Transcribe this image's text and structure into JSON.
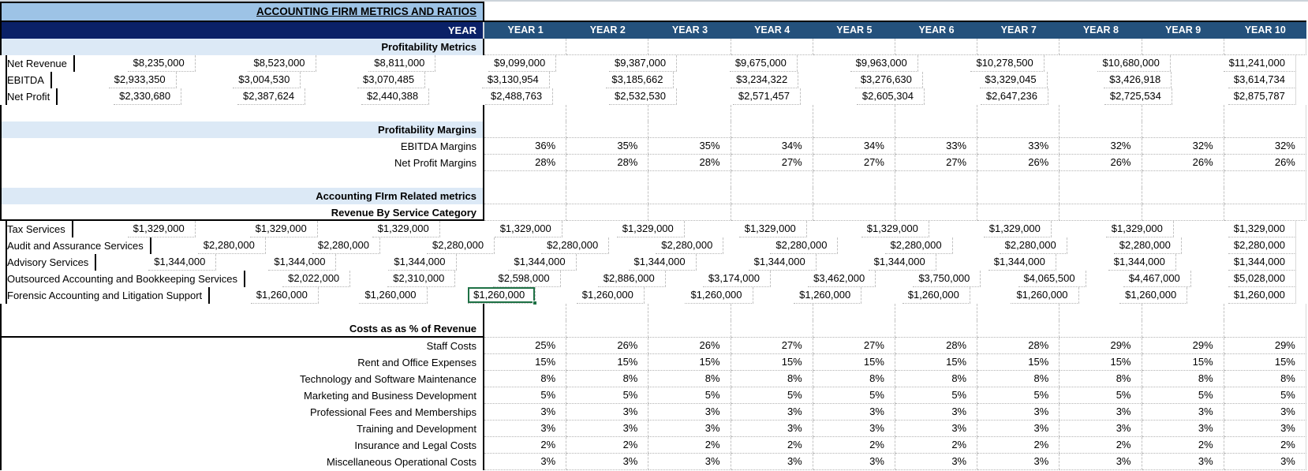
{
  "title": "ACCOUNTING FIRM METRICS AND RATIOS",
  "currency_symbol": "$",
  "header": {
    "label": "YEAR",
    "columns": [
      "YEAR 1",
      "YEAR 2",
      "YEAR 3",
      "YEAR 4",
      "YEAR 5",
      "YEAR 6",
      "YEAR 7",
      "YEAR 8",
      "YEAR 9",
      "YEAR 10"
    ]
  },
  "colors": {
    "title_band": "#9DC3E6",
    "header_label_bg": "#0A2167",
    "header_cols_bg": "#24517C",
    "section_bg": "#DCE9F6",
    "selection_green": "#1E7145",
    "grid_dotted": "#b3b3b3"
  },
  "selection": {
    "row_label": "Forensic Accounting and Litigation Support",
    "column_label": "YEAR 3",
    "row_index": 15,
    "col_index": 2
  },
  "sheet": {
    "rows": [
      {
        "t": "section",
        "label": "Profitability Metrics"
      },
      {
        "t": "money",
        "label": "Net Revenue",
        "values": [
          "8,235,000",
          "8,523,000",
          "8,811,000",
          "9,099,000",
          "9,387,000",
          "9,675,000",
          "9,963,000",
          "10,278,500",
          "10,680,000",
          "11,241,000"
        ]
      },
      {
        "t": "money",
        "label": "EBITDA",
        "values": [
          "2,933,350",
          "3,004,530",
          "3,070,485",
          "3,130,954",
          "3,185,662",
          "3,234,322",
          "3,276,630",
          "3,329,045",
          "3,426,918",
          "3,614,734"
        ]
      },
      {
        "t": "money",
        "label": "Net Profit",
        "values": [
          "2,330,680",
          "2,387,624",
          "2,440,388",
          "2,488,763",
          "2,532,530",
          "2,571,457",
          "2,605,304",
          "2,647,236",
          "2,725,534",
          "2,875,787"
        ]
      },
      {
        "t": "blank"
      },
      {
        "t": "section",
        "label": "Profitability Margins"
      },
      {
        "t": "pct",
        "label": "EBITDA Margins",
        "values": [
          "36%",
          "35%",
          "35%",
          "34%",
          "34%",
          "33%",
          "33%",
          "32%",
          "32%",
          "32%"
        ]
      },
      {
        "t": "pct",
        "label": "Net Profit Margins",
        "values": [
          "28%",
          "28%",
          "28%",
          "27%",
          "27%",
          "27%",
          "26%",
          "26%",
          "26%",
          "26%"
        ]
      },
      {
        "t": "blank"
      },
      {
        "t": "section",
        "label": "Accounting FIrm Related metrics"
      },
      {
        "t": "section_u",
        "label": "Revenue By Service Category"
      },
      {
        "t": "money",
        "label": "Tax Services",
        "values": [
          "1,329,000",
          "1,329,000",
          "1,329,000",
          "1,329,000",
          "1,329,000",
          "1,329,000",
          "1,329,000",
          "1,329,000",
          "1,329,000",
          "1,329,000"
        ]
      },
      {
        "t": "money",
        "label": "Audit and Assurance Services",
        "values": [
          "2,280,000",
          "2,280,000",
          "2,280,000",
          "2,280,000",
          "2,280,000",
          "2,280,000",
          "2,280,000",
          "2,280,000",
          "2,280,000",
          "2,280,000"
        ]
      },
      {
        "t": "money",
        "label": "Advisory Services",
        "values": [
          "1,344,000",
          "1,344,000",
          "1,344,000",
          "1,344,000",
          "1,344,000",
          "1,344,000",
          "1,344,000",
          "1,344,000",
          "1,344,000",
          "1,344,000"
        ]
      },
      {
        "t": "money",
        "label": "Outsourced Accounting and Bookkeeping Services",
        "values": [
          "2,022,000",
          "2,310,000",
          "2,598,000",
          "2,886,000",
          "3,174,000",
          "3,462,000",
          "3,750,000",
          "4,065,500",
          "4,467,000",
          "5,028,000"
        ]
      },
      {
        "t": "money",
        "label": "Forensic Accounting and Litigation Support",
        "values": [
          "1,260,000",
          "1,260,000",
          "1,260,000",
          "1,260,000",
          "1,260,000",
          "1,260,000",
          "1,260,000",
          "1,260,000",
          "1,260,000",
          "1,260,000"
        ]
      },
      {
        "t": "blank"
      },
      {
        "t": "section_u",
        "label": "Costs as as % of Revenue",
        "tall": true
      },
      {
        "t": "pct",
        "label": "Staff Costs",
        "values": [
          "25%",
          "26%",
          "26%",
          "27%",
          "27%",
          "28%",
          "28%",
          "29%",
          "29%",
          "29%"
        ]
      },
      {
        "t": "pct",
        "label": "Rent and Office Expenses",
        "values": [
          "15%",
          "15%",
          "15%",
          "15%",
          "15%",
          "15%",
          "15%",
          "15%",
          "15%",
          "15%"
        ]
      },
      {
        "t": "pct",
        "label": "Technology and Software Maintenance",
        "values": [
          "8%",
          "8%",
          "8%",
          "8%",
          "8%",
          "8%",
          "8%",
          "8%",
          "8%",
          "8%"
        ]
      },
      {
        "t": "pct",
        "label": "Marketing and Business Development",
        "values": [
          "5%",
          "5%",
          "5%",
          "5%",
          "5%",
          "5%",
          "5%",
          "5%",
          "5%",
          "5%"
        ]
      },
      {
        "t": "pct",
        "label": "Professional Fees and Memberships",
        "values": [
          "3%",
          "3%",
          "3%",
          "3%",
          "3%",
          "3%",
          "3%",
          "3%",
          "3%",
          "3%"
        ]
      },
      {
        "t": "pct",
        "label": "Training and Development",
        "values": [
          "3%",
          "3%",
          "3%",
          "3%",
          "3%",
          "3%",
          "3%",
          "3%",
          "3%",
          "3%"
        ]
      },
      {
        "t": "pct",
        "label": "Insurance and Legal Costs",
        "values": [
          "2%",
          "2%",
          "2%",
          "2%",
          "2%",
          "2%",
          "2%",
          "2%",
          "2%",
          "2%"
        ]
      },
      {
        "t": "pct",
        "label": "Miscellaneous Operational Costs",
        "values": [
          "3%",
          "3%",
          "3%",
          "3%",
          "3%",
          "3%",
          "3%",
          "3%",
          "3%",
          "3%"
        ]
      }
    ]
  }
}
